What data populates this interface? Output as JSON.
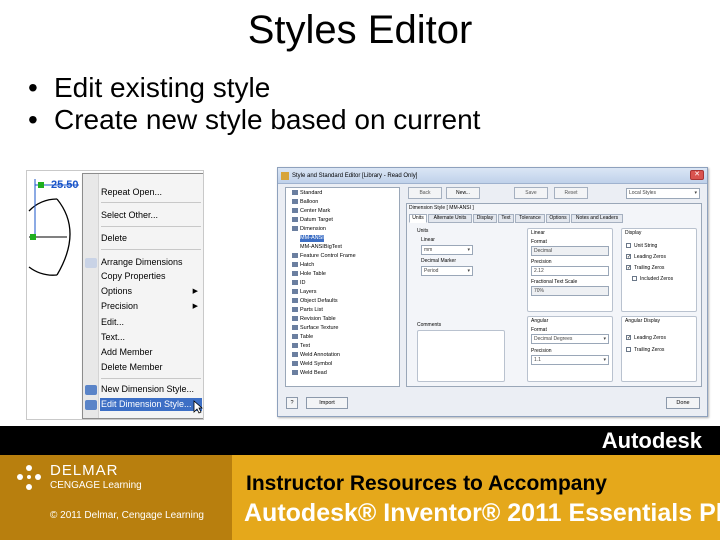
{
  "slide": {
    "title": "Styles Editor",
    "bullets": [
      "Edit existing style",
      "Create new style based on current"
    ]
  },
  "drawing": {
    "dimension_value": "25.50"
  },
  "context_menu": {
    "items": [
      {
        "label": "Repeat Open...",
        "highlighted": false
      },
      {
        "label": "Select Other...",
        "highlighted": false
      },
      {
        "label": "Delete",
        "highlighted": false
      },
      {
        "label": "Arrange Dimensions",
        "highlighted": false
      },
      {
        "label": "Copy Properties",
        "highlighted": false
      },
      {
        "label": "Options",
        "highlighted": false,
        "submenu": true
      },
      {
        "label": "Precision",
        "highlighted": false,
        "submenu": true
      },
      {
        "label": "Edit...",
        "highlighted": false
      },
      {
        "label": "Text...",
        "highlighted": false
      },
      {
        "label": "Add Member",
        "highlighted": false
      },
      {
        "label": "Delete Member",
        "highlighted": false
      },
      {
        "label": "New Dimension Style...",
        "highlighted": false
      },
      {
        "label": "Edit Dimension Style...",
        "highlighted": true
      }
    ]
  },
  "editor": {
    "window_title": "Style and Standard Editor [Library - Read Only]",
    "toolbar": {
      "back": "Back",
      "new": "New...",
      "save": "Save",
      "reset": "Reset",
      "filter": "Local Styles"
    },
    "tree": [
      "Standard",
      "Balloon",
      "Center Mark",
      "Datum Target",
      "Dimension",
      "MM-ANSI",
      "MM-ANSIBigText",
      "Feature Control Frame",
      "Hatch",
      "Hole Table",
      "ID",
      "Layers",
      "Object Defaults",
      "Parts List",
      "Revision Table",
      "Surface Texture",
      "Table",
      "Text",
      "Weld Annotation",
      "Weld Symbol",
      "Weld Bead"
    ],
    "selected_tree_item": "MM-ANSI",
    "panel_title": "Dimension Style [ MM-ANSI ]",
    "tabs": [
      "Units",
      "Alternate Units",
      "Display",
      "Text",
      "Tolerance",
      "Options",
      "Notes and Leaders"
    ],
    "active_tab": "Units",
    "units": {
      "units_label": "Units",
      "linear_label": "Linear",
      "linear_value": "mm",
      "decimal_marker_label": "Decimal Marker",
      "decimal_marker_value": "Period",
      "comments_label": "Comments"
    },
    "linear_group": {
      "title": "Linear",
      "format_label": "Format",
      "format_value": "Decimal",
      "precision_label": "Precision",
      "precision_value": "2.12",
      "fractional_label": "Fractional Text Scale",
      "fractional_value": "70%"
    },
    "display_group": {
      "title": "Display",
      "options": [
        {
          "label": "Unit String",
          "checked": false
        },
        {
          "label": "Leading Zeros",
          "checked": true
        },
        {
          "label": "Trailing Zeros",
          "checked": true
        },
        {
          "label": "Included Zeros",
          "checked": false
        }
      ]
    },
    "angular_group": {
      "title": "Angular",
      "format_label": "Format",
      "format_value": "Decimal Degrees",
      "precision_label": "Precision",
      "precision_value": "1.1"
    },
    "angular_display": {
      "title": "Angular Display",
      "options": [
        {
          "label": "Leading Zeros",
          "checked": true
        },
        {
          "label": "Trailing Zeros",
          "checked": false
        }
      ]
    },
    "footer": {
      "import": "Import",
      "done": "Done"
    }
  },
  "footer": {
    "brand": "Autodesk",
    "publisher": "DELMAR",
    "publisher_sub": "CENGAGE Learning",
    "copyright": "© 2011 Delmar, Cengage Learning",
    "pitch_line1": "Instructor Resources to Accompany",
    "pitch_line2": "Autodesk® Inventor® 2011 Essentials Plus"
  },
  "colors": {
    "menu_highlight": "#3d6fc5",
    "footer_band": "#e5a81b",
    "footer_band_dark": "#b87f0e",
    "dimension_blue": "#1a55c9"
  }
}
